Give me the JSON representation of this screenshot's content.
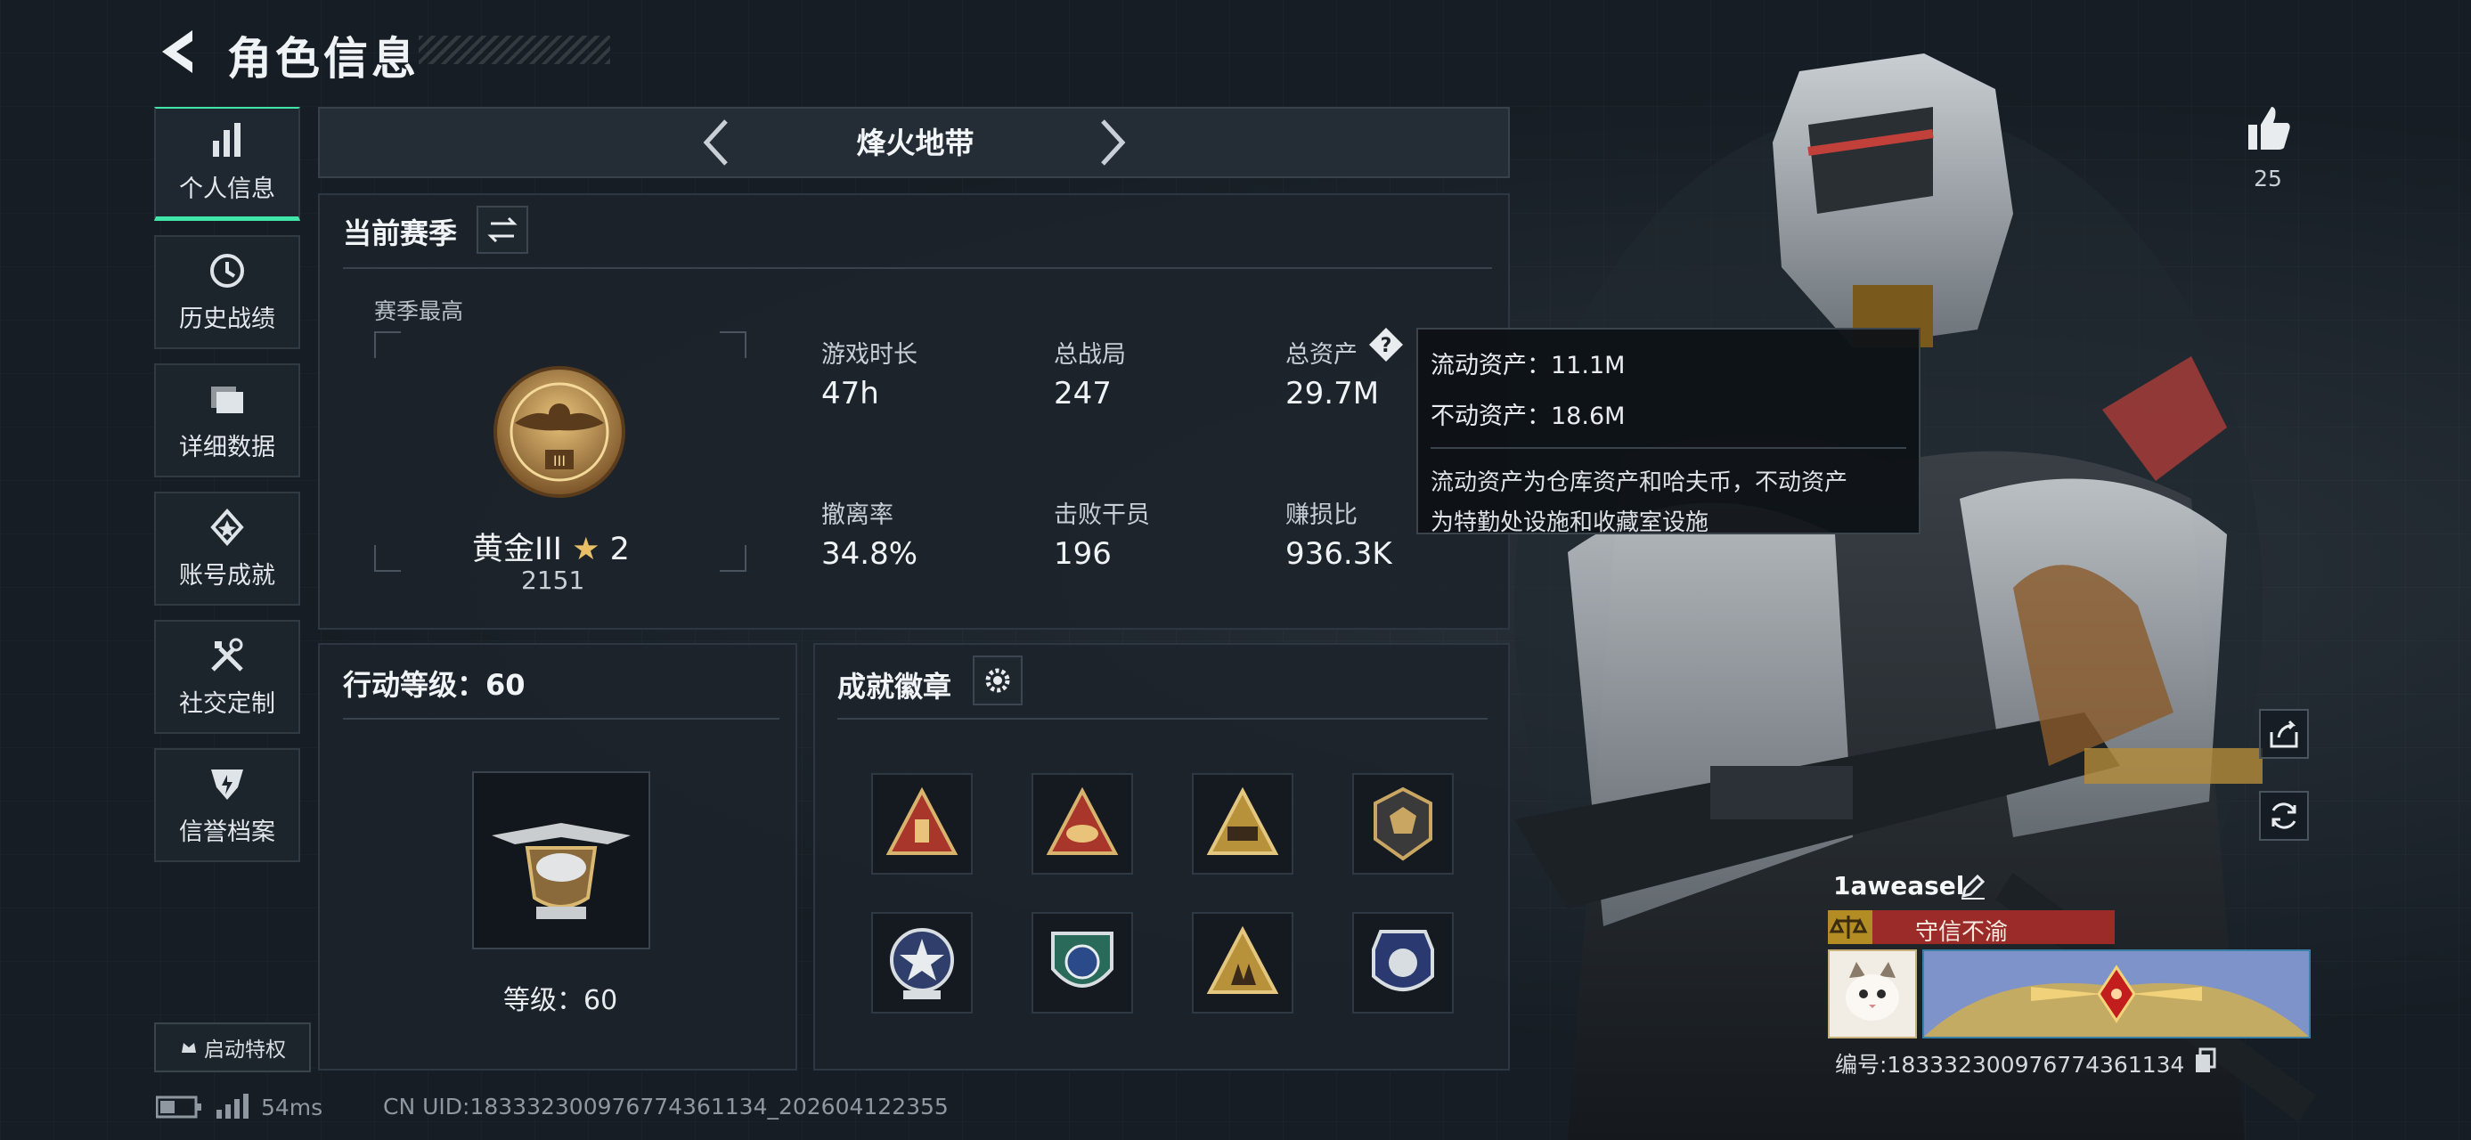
{
  "header": {
    "title": "角色信息",
    "back_icon": "back-arrow-icon"
  },
  "sidebar": {
    "items": [
      {
        "label": "个人信息",
        "icon": "bar-chart-icon",
        "active": true
      },
      {
        "label": "历史战绩",
        "icon": "history-clock-icon",
        "active": false
      },
      {
        "label": "详细数据",
        "icon": "folder-icon",
        "active": false
      },
      {
        "label": "账号成就",
        "icon": "achievement-medal-icon",
        "active": false
      },
      {
        "label": "社交定制",
        "icon": "tools-icon",
        "active": false
      },
      {
        "label": "信誉档案",
        "icon": "shield-badge-icon",
        "active": false
      }
    ],
    "privilege_button": "启动特权"
  },
  "mode_selector": {
    "current": "烽火地带"
  },
  "season": {
    "title": "当前赛季",
    "best_label": "赛季最高",
    "rank_name": "黄金III",
    "rank_stars": "2",
    "rank_score": "2151",
    "stats": [
      {
        "label": "游戏时长",
        "value": "47h"
      },
      {
        "label": "总战局",
        "value": "247"
      },
      {
        "label": "总资产",
        "value": "29.7M"
      },
      {
        "label": "撤离率",
        "value": "34.8%"
      },
      {
        "label": "击败干员",
        "value": "196"
      },
      {
        "label": "赚损比",
        "value": "936.3K"
      }
    ]
  },
  "tooltip": {
    "liquid": "流动资产：11.1M",
    "fixed": "不动资产：18.6M",
    "desc_line1": "流动资产为仓库资产和哈夫币，不动资产",
    "desc_line2": "为特勤处设施和收藏室设施"
  },
  "level": {
    "title": "行动等级：60",
    "label": "等级：60"
  },
  "achievements": {
    "title": "成就徽章",
    "badges": [
      "badge-1",
      "badge-2",
      "badge-3",
      "badge-4",
      "badge-5",
      "badge-6",
      "badge-7",
      "badge-8"
    ]
  },
  "status_bar": {
    "latency": "54ms",
    "uid": "CN UID:1833323009767743611​34_202604122355"
  },
  "profile": {
    "likes": "25",
    "player_name": "1aweasel",
    "trust_label": "守信不渝",
    "serial": "编号:1833323009767743611​34"
  },
  "colors": {
    "accent": "#40e6a8",
    "trust_red": "#9b2b28",
    "gold": "#b38d24"
  }
}
